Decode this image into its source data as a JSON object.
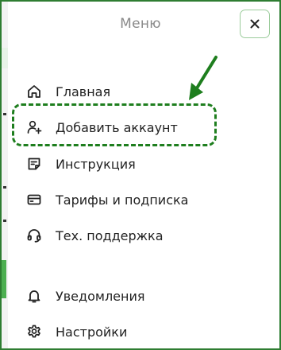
{
  "menu": {
    "title": "Меню",
    "close_label": "×",
    "items": [
      {
        "label": "Главная",
        "icon": "home-icon"
      },
      {
        "label": "Добавить аккаунт",
        "icon": "add-user-icon"
      },
      {
        "label": "Инструкция",
        "icon": "note-icon"
      },
      {
        "label": "Тарифы и подписка",
        "icon": "credit-card-icon"
      },
      {
        "label": "Тех. поддержка",
        "icon": "headset-icon"
      },
      {
        "label": "Уведомления",
        "icon": "bell-icon"
      },
      {
        "label": "Настройки",
        "icon": "gear-icon"
      }
    ]
  },
  "annotation": {
    "color": "#1e7e1e"
  },
  "colors": {
    "accent": "#2e7d32",
    "title": "#8a8a8a",
    "text": "#222222"
  }
}
